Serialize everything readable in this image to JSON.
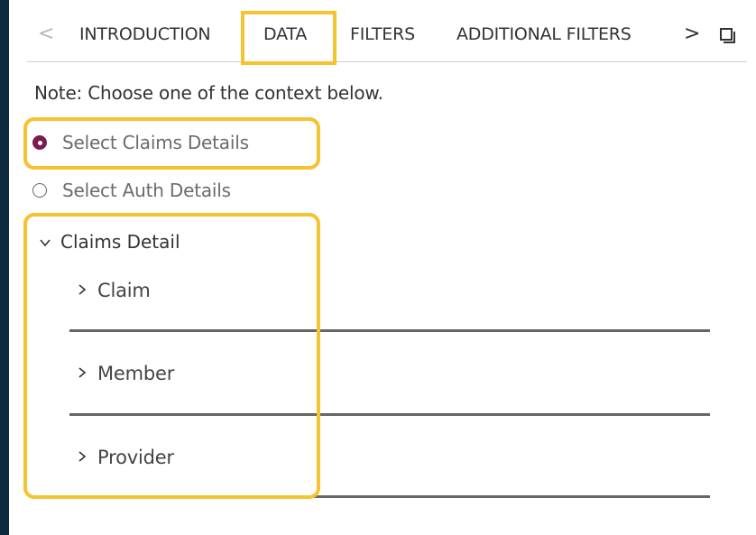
{
  "tabs": {
    "prev_arrow": "<",
    "next_arrow": ">",
    "items": [
      "INTRODUCTION",
      "DATA",
      "FILTERS",
      "ADDITIONAL FILTERS"
    ],
    "active": "DATA"
  },
  "note": "Note: Choose one of the context below.",
  "context_options": [
    {
      "label": "Select Claims Details",
      "checked": true
    },
    {
      "label": "Select Auth Details",
      "checked": false
    }
  ],
  "tree": {
    "header": "Claims Detail",
    "items": [
      "Claim",
      "Member",
      "Provider"
    ]
  },
  "icons": {
    "prev": "chevron-left-icon",
    "next": "chevron-right-icon",
    "window": "window-icon",
    "expand": "chevron-down-icon",
    "collapse": "chevron-right-icon"
  },
  "colors": {
    "accent": "#7a1c4f",
    "highlight": "#f5c230",
    "frame": "#0e2a3f"
  }
}
